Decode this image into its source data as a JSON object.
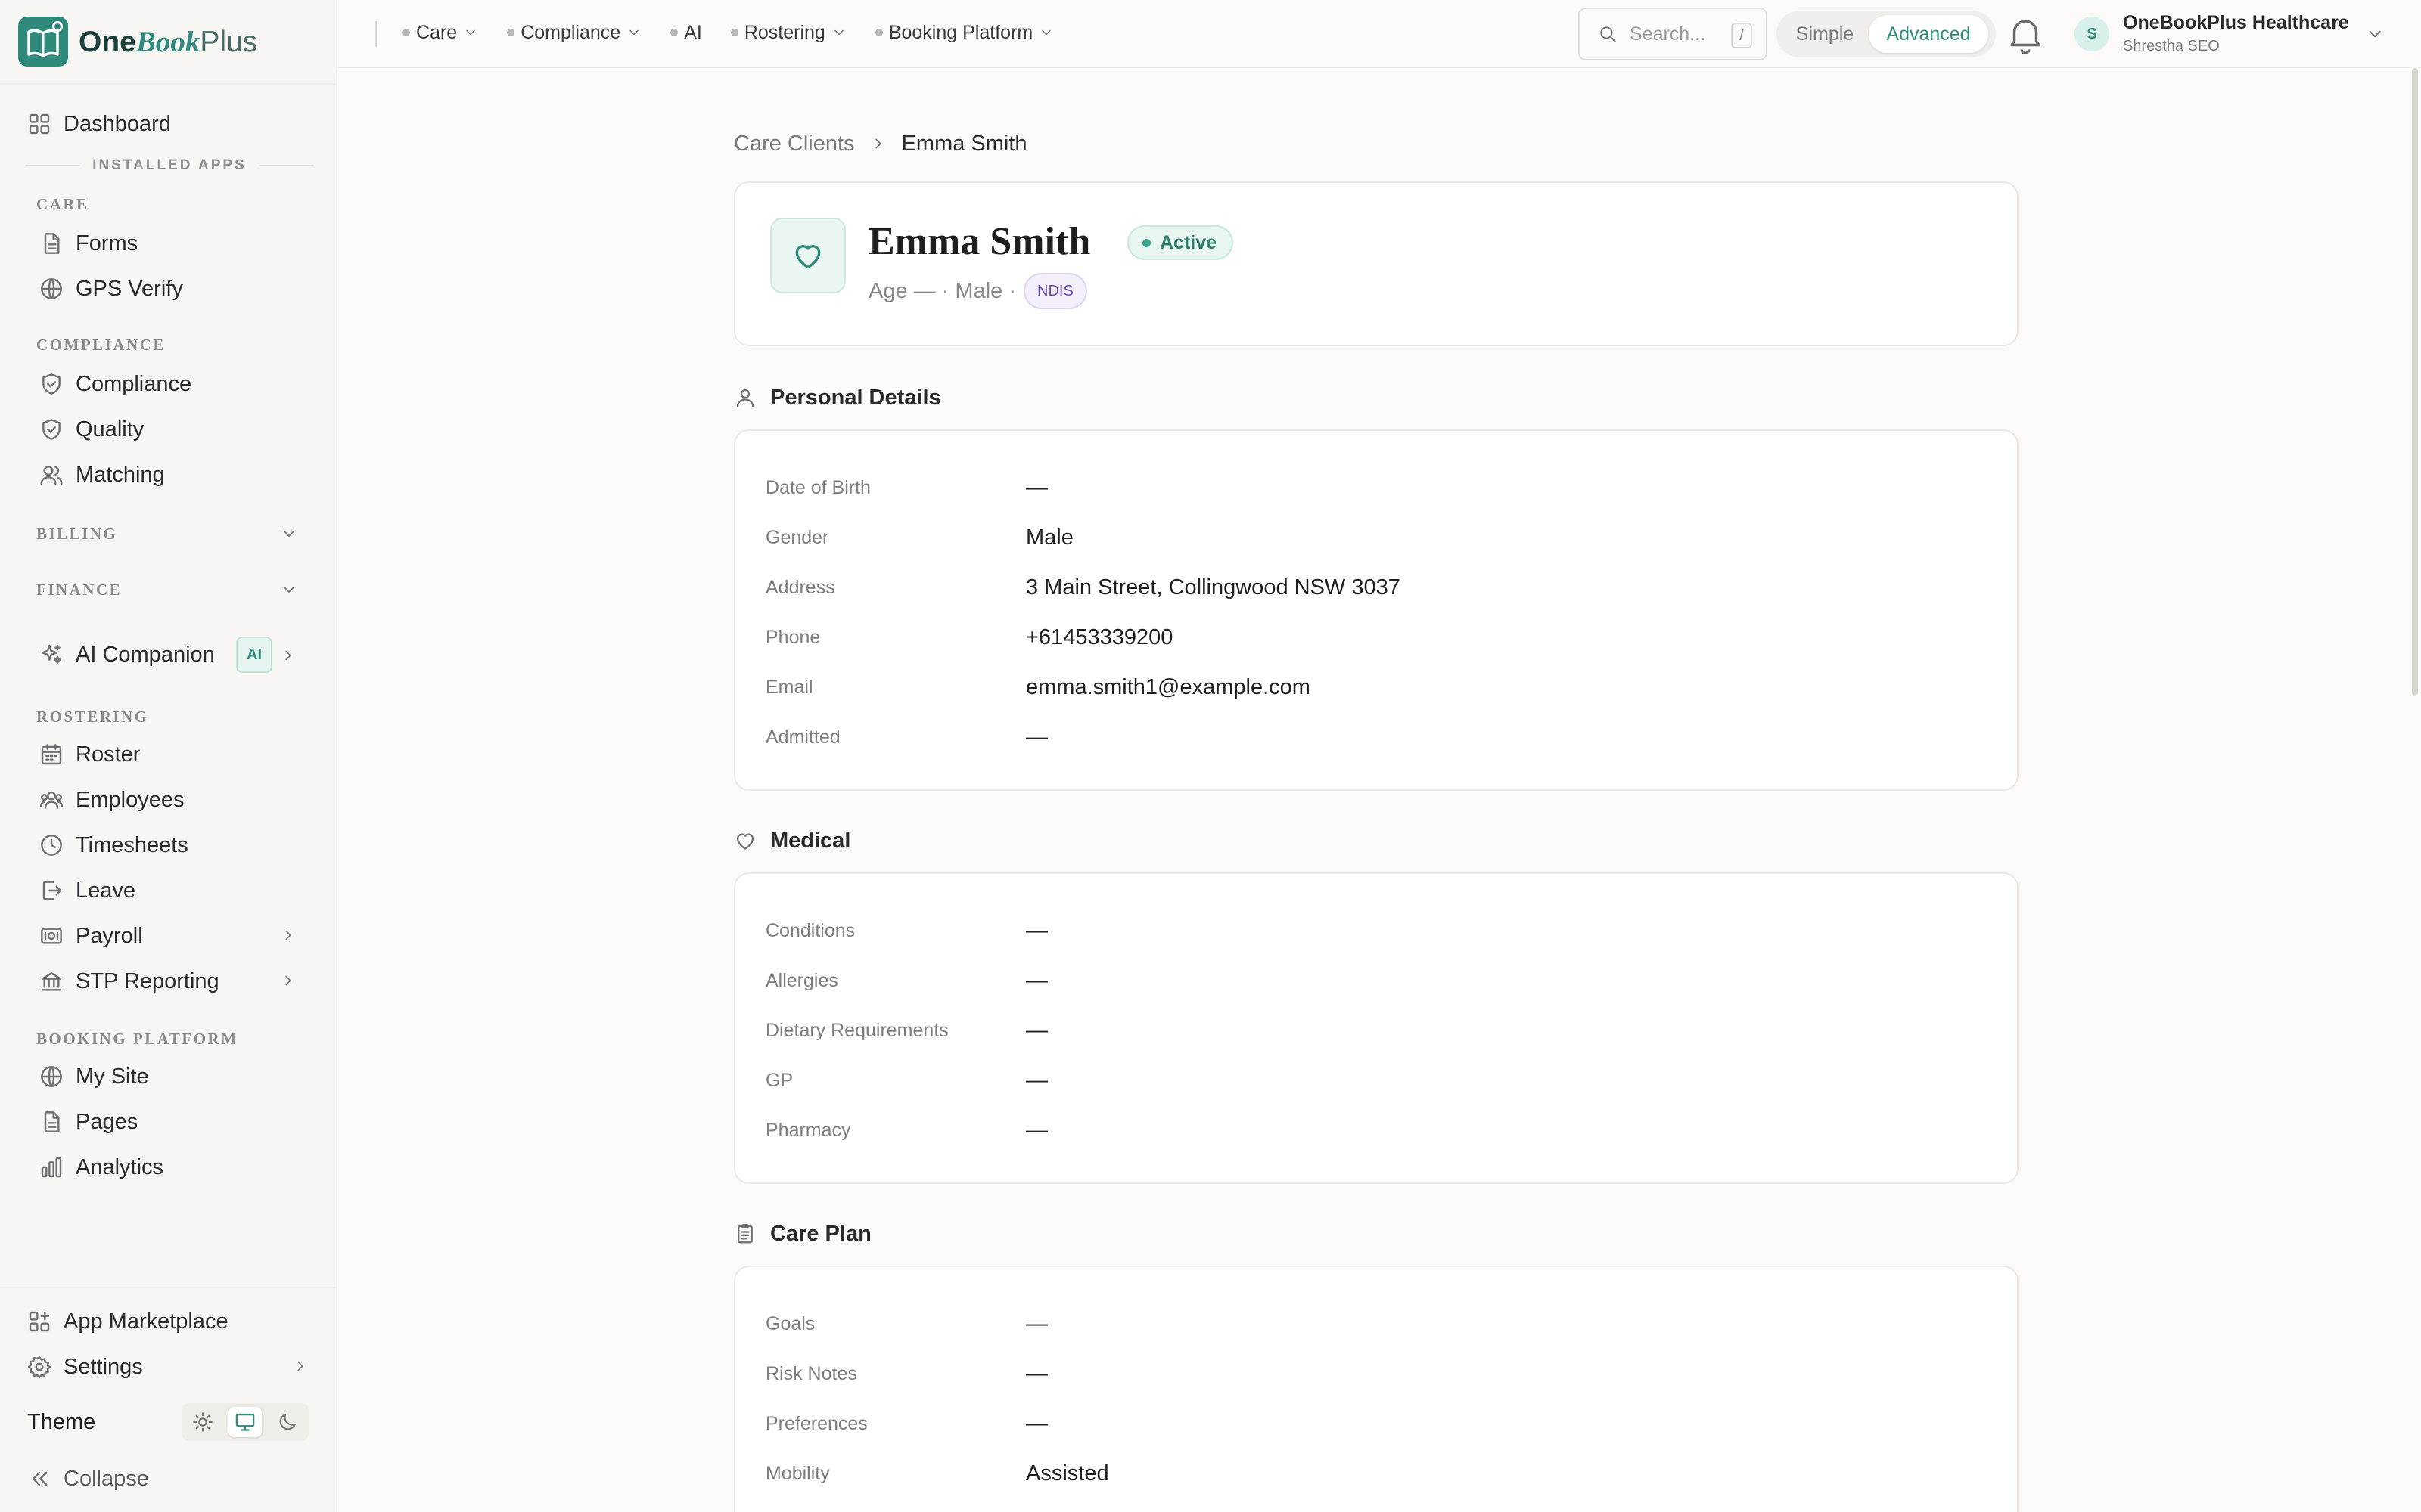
{
  "app": {
    "logo_one": "One",
    "logo_book": "Book",
    "logo_plus": "Plus",
    "brand_color": "#2f8a7b"
  },
  "sidebar": {
    "dashboard": "Dashboard",
    "installed_apps": "INSTALLED APPS",
    "sections": {
      "care": "CARE",
      "compliance": "COMPLIANCE",
      "billing": "BILLING",
      "finance": "FINANCE",
      "rostering": "ROSTERING",
      "booking_platform": "BOOKING PLATFORM"
    },
    "items": {
      "forms": "Forms",
      "gps_verify": "GPS Verify",
      "compliance": "Compliance",
      "quality": "Quality",
      "matching": "Matching",
      "ai_companion": "AI Companion",
      "ai_badge": "AI",
      "roster": "Roster",
      "employees": "Employees",
      "timesheets": "Timesheets",
      "leave": "Leave",
      "payroll": "Payroll",
      "stp_reporting": "STP Reporting",
      "my_site": "My Site",
      "pages": "Pages",
      "analytics": "Analytics"
    },
    "app_marketplace": "App Marketplace",
    "settings": "Settings",
    "theme": "Theme",
    "collapse": "Collapse"
  },
  "topbar": {
    "nav": [
      "Care",
      "Compliance",
      "AI",
      "Rostering",
      "Booking Platform"
    ],
    "search_placeholder": "Search...",
    "search_shortcut": "/",
    "mode_simple": "Simple",
    "mode_advanced": "Advanced",
    "account_initial": "S",
    "account_name": "OneBookPlus Healthcare",
    "account_sub": "Shrestha SEO"
  },
  "breadcrumb": {
    "parent": "Care Clients",
    "current": "Emma Smith"
  },
  "client": {
    "name": "Emma Smith",
    "status": "Active",
    "meta": "Age — · Male ·",
    "funding": "NDIS"
  },
  "personal": {
    "title": "Personal Details",
    "fields": [
      {
        "label": "Date of Birth",
        "value": "—"
      },
      {
        "label": "Gender",
        "value": "Male"
      },
      {
        "label": "Address",
        "value": "3 Main Street, Collingwood NSW 3037"
      },
      {
        "label": "Phone",
        "value": "+61453339200"
      },
      {
        "label": "Email",
        "value": "emma.smith1@example.com"
      },
      {
        "label": "Admitted",
        "value": "—"
      }
    ]
  },
  "medical": {
    "title": "Medical",
    "fields": [
      {
        "label": "Conditions",
        "value": "—"
      },
      {
        "label": "Allergies",
        "value": "—"
      },
      {
        "label": "Dietary Requirements",
        "value": "—"
      },
      {
        "label": "GP",
        "value": "—"
      },
      {
        "label": "Pharmacy",
        "value": "—"
      }
    ]
  },
  "care_plan": {
    "title": "Care Plan",
    "fields": [
      {
        "label": "Goals",
        "value": "—"
      },
      {
        "label": "Risk Notes",
        "value": "—"
      },
      {
        "label": "Preferences",
        "value": "—"
      },
      {
        "label": "Mobility",
        "value": "Assisted"
      }
    ]
  }
}
